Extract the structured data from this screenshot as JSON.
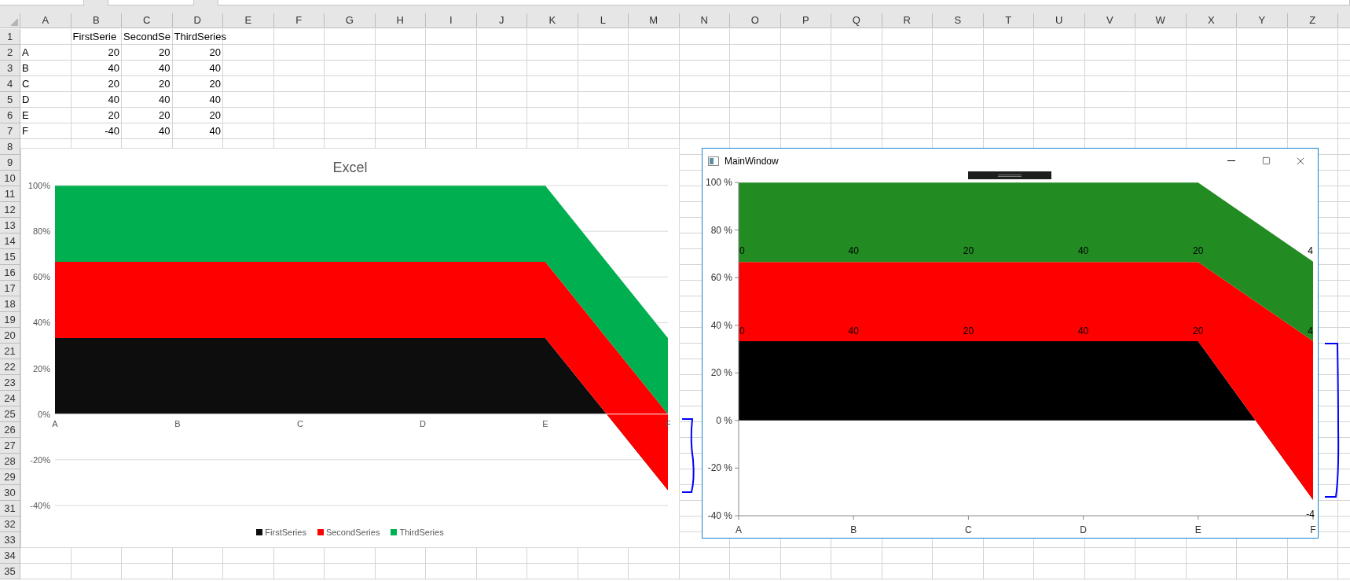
{
  "spreadsheet": {
    "column_headers": [
      "A",
      "B",
      "C",
      "D",
      "E",
      "F",
      "G",
      "H",
      "I",
      "J",
      "K",
      "L",
      "M",
      "N",
      "O",
      "P",
      "Q",
      "R",
      "S",
      "T",
      "U",
      "V",
      "W",
      "X",
      "Y",
      "Z"
    ],
    "row_numbers": [
      "1",
      "2",
      "3",
      "4",
      "5",
      "6",
      "7",
      "8",
      "9",
      "10",
      "11",
      "12",
      "13",
      "14",
      "15",
      "16",
      "17",
      "18",
      "19",
      "20",
      "21",
      "22",
      "23",
      "24",
      "25",
      "26",
      "27",
      "28",
      "29",
      "30",
      "31",
      "32",
      "33",
      "34",
      "35"
    ],
    "header_row": [
      "FirstSerie",
      "SecondSe",
      "ThirdSeries"
    ],
    "data_rows": [
      {
        "label": "A",
        "values": [
          "20",
          "20",
          "20"
        ]
      },
      {
        "label": "B",
        "values": [
          "40",
          "40",
          "40"
        ]
      },
      {
        "label": "C",
        "values": [
          "20",
          "20",
          "20"
        ]
      },
      {
        "label": "D",
        "values": [
          "40",
          "40",
          "40"
        ]
      },
      {
        "label": "E",
        "values": [
          "20",
          "20",
          "20"
        ]
      },
      {
        "label": "F",
        "values": [
          "-40",
          "40",
          "40"
        ]
      }
    ]
  },
  "excel_chart": {
    "kind": "excel",
    "chart_data": {
      "type": "area",
      "title": "Excel",
      "stacked": true,
      "grid": true,
      "legend": "bottom",
      "categories": [
        "A",
        "B",
        "C",
        "D",
        "E",
        "F"
      ],
      "series": [
        {
          "name": "FirstSeries",
          "color": "#0d0d0d",
          "values": [
            33.3,
            33.3,
            33.3,
            33.3,
            33.3,
            -33.3
          ]
        },
        {
          "name": "SecondSeries",
          "color": "#ff0000",
          "values": [
            33.3,
            33.3,
            33.3,
            33.3,
            33.3,
            33.3
          ]
        },
        {
          "name": "ThirdSeries",
          "color": "#00b050",
          "values": [
            33.3,
            33.3,
            33.3,
            33.3,
            33.3,
            33.3
          ]
        }
      ],
      "ylim": [
        -40,
        100
      ],
      "yticks": [
        {
          "value": 100,
          "label": "100%"
        },
        {
          "value": 80,
          "label": "80%"
        },
        {
          "value": 60,
          "label": "60%"
        },
        {
          "value": 40,
          "label": "40%"
        },
        {
          "value": 20,
          "label": "20%"
        },
        {
          "value": 0,
          "label": "0%"
        },
        {
          "value": -20,
          "label": "-20%"
        },
        {
          "value": -40,
          "label": "-40%"
        }
      ]
    }
  },
  "wpf_window": {
    "kind": "wpf",
    "title": "MainWindow",
    "chart_data": {
      "type": "area",
      "stacked": true,
      "categories": [
        "A",
        "B",
        "C",
        "D",
        "E",
        "F"
      ],
      "series": [
        {
          "color": "#000000",
          "values": [
            33.3,
            33.3,
            33.3,
            33.3,
            33.3,
            -33.3
          ]
        },
        {
          "color": "#ff0000",
          "values": [
            33.3,
            33.3,
            33.3,
            33.3,
            33.3,
            66.7
          ]
        },
        {
          "color": "#228b22",
          "values": [
            33.3,
            33.3,
            33.3,
            33.3,
            33.3,
            33.3
          ]
        }
      ],
      "ylim": [
        -40,
        100
      ],
      "yticks": [
        {
          "value": 100,
          "label": "100 %"
        },
        {
          "value": 80,
          "label": "80 %"
        },
        {
          "value": 60,
          "label": "60 %"
        },
        {
          "value": 40,
          "label": "40 %"
        },
        {
          "value": 20,
          "label": "20 %"
        },
        {
          "value": 0,
          "label": "0 %"
        },
        {
          "value": -20,
          "label": "-20 %"
        },
        {
          "value": -40,
          "label": "-40 %"
        }
      ]
    },
    "data_label_rows": [
      [
        "0",
        "40",
        "20",
        "40",
        "20",
        "4"
      ],
      [
        "0",
        "40",
        "20",
        "40",
        "20",
        "4"
      ]
    ],
    "corner_label": "-4"
  }
}
